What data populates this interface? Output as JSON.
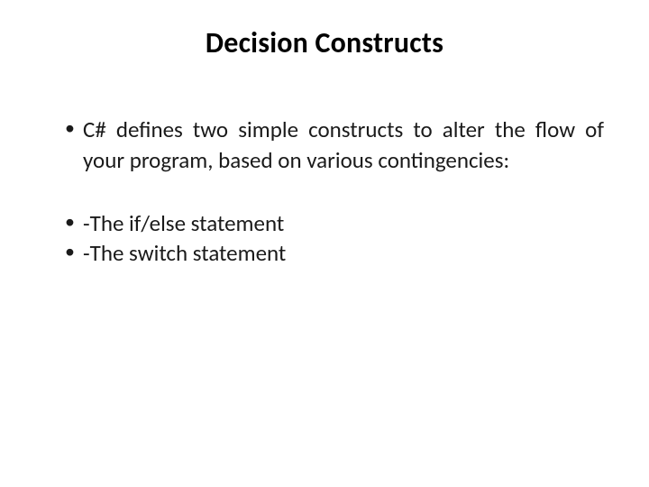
{
  "slide": {
    "title": "Decision Constructs",
    "bullets": [
      "C# defines two simple constructs to alter the flow of your program, based on various contingencies:",
      "-The if/else statement",
      "-The switch statement"
    ]
  }
}
